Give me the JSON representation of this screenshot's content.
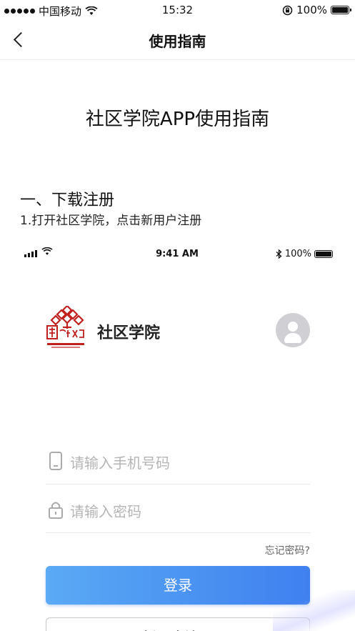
{
  "status_bar": {
    "carrier": "中国移动",
    "time": "15:32",
    "battery": "100%"
  },
  "nav": {
    "title": "使用指南"
  },
  "doc": {
    "title": "社区学院APP使用指南",
    "section1_title": "一、下载注册",
    "step1": "1.打开社区学院，点击新用户注册"
  },
  "inner_screen": {
    "status": {
      "time": "9:41 AM",
      "battery": "100%"
    },
    "brand_name": "社区学院",
    "logo_text": "学在社区",
    "phone_placeholder": "请输入手机号码",
    "password_placeholder": "请输入密码",
    "forgot_label": "忘记密码?",
    "login_label": "登录",
    "register_label": "新用户注册"
  },
  "colors": {
    "accent_start": "#5aaaf5",
    "accent_end": "#3f80ef",
    "logo_red": "#c0201e"
  }
}
